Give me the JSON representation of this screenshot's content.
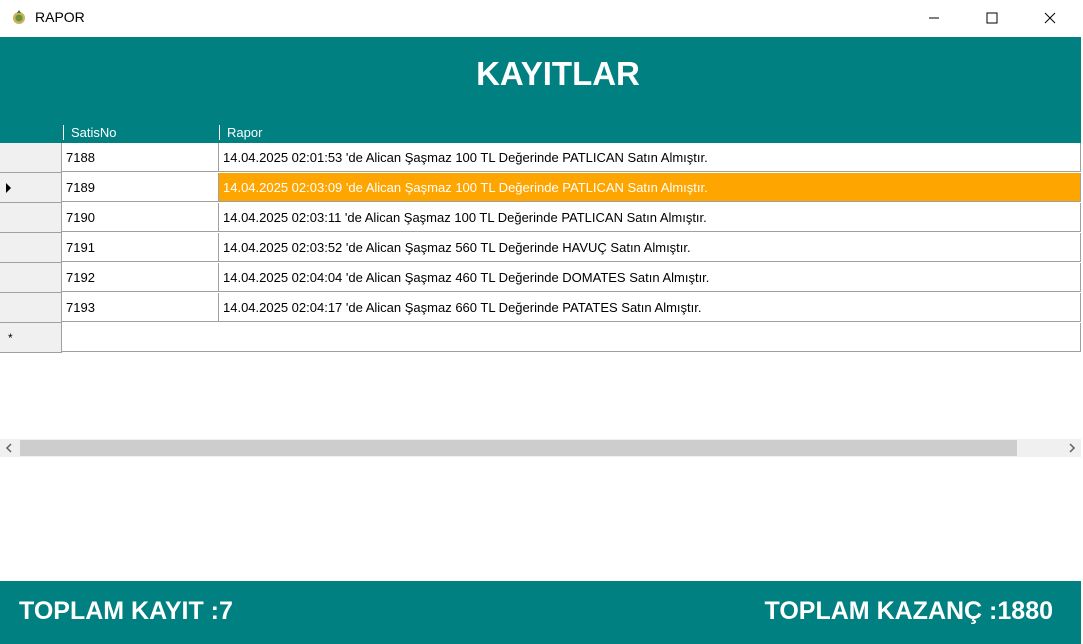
{
  "window": {
    "title": "RAPOR",
    "icon": "app-leaf-icon",
    "controls": [
      "minimize-icon",
      "maximize-icon",
      "close-icon"
    ]
  },
  "header": {
    "title": "KAYITLAR"
  },
  "grid": {
    "columns": [
      "SatisNo",
      "Rapor"
    ],
    "rows": [
      {
        "satis_no": "7188",
        "rapor": "14.04.2025 02:01:53 'de Alican Şaşmaz 100 TL Değerinde  PATLICAN  Satın Almıştır."
      },
      {
        "satis_no": "7189",
        "rapor": "14.04.2025 02:03:09 'de Alican Şaşmaz 100 TL Değerinde  PATLICAN  Satın Almıştır."
      },
      {
        "satis_no": "7190",
        "rapor": "14.04.2025 02:03:11 'de Alican Şaşmaz 100 TL Değerinde  PATLICAN  Satın Almıştır."
      },
      {
        "satis_no": "7191",
        "rapor": "14.04.2025 02:03:52 'de Alican Şaşmaz 560 TL Değerinde  HAVUÇ  Satın Almıştır."
      },
      {
        "satis_no": "7192",
        "rapor": "14.04.2025 02:04:04 'de Alican Şaşmaz 460 TL Değerinde  DOMATES  Satın Almıştır."
      },
      {
        "satis_no": "7193",
        "rapor": "14.04.2025 02:04:17 'de Alican Şaşmaz 660 TL Değerinde  PATATES  Satın Almıştır."
      }
    ],
    "current_row_marker": "current-row-arrow-icon",
    "new_row_marker": "*"
  },
  "footer": {
    "total_records": "TOPLAM KAYIT :7",
    "total_earnings": "TOPLAM KAZANÇ :1880"
  },
  "colors": {
    "header_bg": "#008080",
    "selection": "#ffa500"
  }
}
